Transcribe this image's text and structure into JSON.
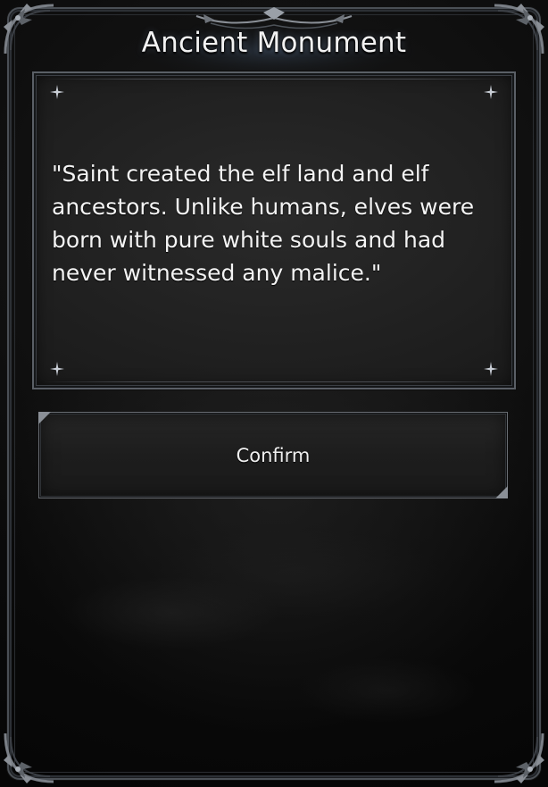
{
  "dialog": {
    "title": "Ancient Monument",
    "body_text": "\"Saint created the elf land and elf ancestors. Unlike humans, elves were born with pure white souls and had never witnessed any malice.\"",
    "confirm_label": "Confirm"
  },
  "colors": {
    "frame": "#4a4f55",
    "panel_bg": "#202020",
    "text": "#f4f4f4",
    "background": "#0b0b0b"
  },
  "icons": {
    "corner_ornament": "ornate-corner-icon",
    "panel_corner": "sparkle-star-icon",
    "header_ornament": "filigree-header-icon"
  }
}
